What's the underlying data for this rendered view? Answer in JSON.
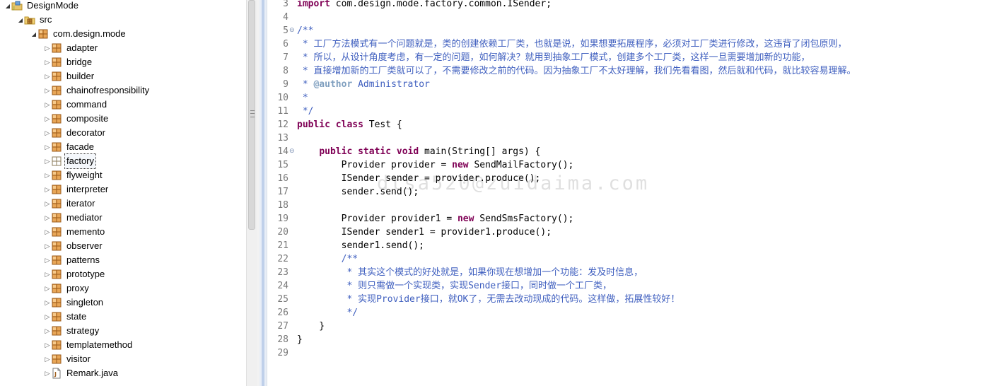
{
  "tree": {
    "items": [
      {
        "depth": 0,
        "twisty": "open",
        "icon": "project-icon",
        "label": "DesignMode"
      },
      {
        "depth": 1,
        "twisty": "open",
        "icon": "source-folder-icon",
        "label": "src"
      },
      {
        "depth": 2,
        "twisty": "open",
        "icon": "package-icon",
        "label": "com.design.mode"
      },
      {
        "depth": 3,
        "twisty": "closed",
        "icon": "package-icon",
        "label": "adapter"
      },
      {
        "depth": 3,
        "twisty": "closed",
        "icon": "package-icon",
        "label": "bridge"
      },
      {
        "depth": 3,
        "twisty": "closed",
        "icon": "package-icon",
        "label": "builder"
      },
      {
        "depth": 3,
        "twisty": "closed",
        "icon": "package-icon",
        "label": "chainofresponsibility"
      },
      {
        "depth": 3,
        "twisty": "closed",
        "icon": "package-icon",
        "label": "command"
      },
      {
        "depth": 3,
        "twisty": "closed",
        "icon": "package-icon",
        "label": "composite"
      },
      {
        "depth": 3,
        "twisty": "closed",
        "icon": "package-icon",
        "label": "decorator"
      },
      {
        "depth": 3,
        "twisty": "closed",
        "icon": "package-icon",
        "label": "facade"
      },
      {
        "depth": 3,
        "twisty": "closed",
        "icon": "empty-package-icon",
        "label": "factory",
        "selected": true
      },
      {
        "depth": 3,
        "twisty": "closed",
        "icon": "package-icon",
        "label": "flyweight"
      },
      {
        "depth": 3,
        "twisty": "closed",
        "icon": "package-icon",
        "label": "interpreter"
      },
      {
        "depth": 3,
        "twisty": "closed",
        "icon": "package-icon",
        "label": "iterator"
      },
      {
        "depth": 3,
        "twisty": "closed",
        "icon": "package-icon",
        "label": "mediator"
      },
      {
        "depth": 3,
        "twisty": "closed",
        "icon": "package-icon",
        "label": "memento"
      },
      {
        "depth": 3,
        "twisty": "closed",
        "icon": "package-icon",
        "label": "observer"
      },
      {
        "depth": 3,
        "twisty": "closed",
        "icon": "package-icon",
        "label": "patterns"
      },
      {
        "depth": 3,
        "twisty": "closed",
        "icon": "package-icon",
        "label": "prototype"
      },
      {
        "depth": 3,
        "twisty": "closed",
        "icon": "package-icon",
        "label": "proxy"
      },
      {
        "depth": 3,
        "twisty": "closed",
        "icon": "package-icon",
        "label": "singleton"
      },
      {
        "depth": 3,
        "twisty": "closed",
        "icon": "package-icon",
        "label": "state"
      },
      {
        "depth": 3,
        "twisty": "closed",
        "icon": "package-icon",
        "label": "strategy"
      },
      {
        "depth": 3,
        "twisty": "closed",
        "icon": "package-icon",
        "label": "templatemethod"
      },
      {
        "depth": 3,
        "twisty": "closed",
        "icon": "package-icon",
        "label": "visitor"
      },
      {
        "depth": 3,
        "twisty": "closed",
        "icon": "java-file-icon",
        "label": "Remark.java"
      }
    ]
  },
  "editor": {
    "watermark": "dtsa520@zuidaima.com",
    "fold_lines": [
      "5",
      "14"
    ],
    "lines": [
      {
        "num": "3",
        "tokens": [
          {
            "t": "import",
            "c": "kw"
          },
          {
            "t": " com.design.mode.factory.common.ISender;",
            "c": ""
          }
        ]
      },
      {
        "num": "4",
        "tokens": []
      },
      {
        "num": "5",
        "tokens": [
          {
            "t": "/**",
            "c": "doc"
          }
        ]
      },
      {
        "num": "6",
        "tokens": [
          {
            "t": " * 工厂方法模式有一个问题就是，类的创建依赖工厂类，也就是说，如果想要拓展程序，必须对工厂类进行修改，这违背了闭包原则，",
            "c": "doc"
          }
        ]
      },
      {
        "num": "7",
        "tokens": [
          {
            "t": " * 所以，从设计角度考虑，有一定的问题，如何解决？就用到抽象工厂模式，创建多个工厂类，这样一旦需要增加新的功能，",
            "c": "doc"
          }
        ]
      },
      {
        "num": "8",
        "tokens": [
          {
            "t": " * 直接增加新的工厂类就可以了，不需要修改之前的代码。因为抽象工厂不太好理解，我们先看看图，然后就和代码，就比较容易理解。",
            "c": "doc"
          }
        ]
      },
      {
        "num": "9",
        "tokens": [
          {
            "t": " * ",
            "c": "doc"
          },
          {
            "t": "@author",
            "c": "tag"
          },
          {
            "t": " Administrator",
            "c": "doc"
          }
        ]
      },
      {
        "num": "10",
        "tokens": [
          {
            "t": " *",
            "c": "doc"
          }
        ]
      },
      {
        "num": "11",
        "tokens": [
          {
            "t": " */",
            "c": "doc"
          }
        ]
      },
      {
        "num": "12",
        "tokens": [
          {
            "t": "public",
            "c": "kw"
          },
          {
            "t": " ",
            "c": ""
          },
          {
            "t": "class",
            "c": "kw"
          },
          {
            "t": " Test {",
            "c": ""
          }
        ]
      },
      {
        "num": "13",
        "tokens": []
      },
      {
        "num": "14",
        "tokens": [
          {
            "t": "    ",
            "c": ""
          },
          {
            "t": "public",
            "c": "kw"
          },
          {
            "t": " ",
            "c": ""
          },
          {
            "t": "static",
            "c": "kw"
          },
          {
            "t": " ",
            "c": ""
          },
          {
            "t": "void",
            "c": "kw"
          },
          {
            "t": " main(String[] args) {",
            "c": ""
          }
        ]
      },
      {
        "num": "15",
        "tokens": [
          {
            "t": "        Provider provider = ",
            "c": ""
          },
          {
            "t": "new",
            "c": "kw"
          },
          {
            "t": " SendMailFactory();",
            "c": ""
          }
        ]
      },
      {
        "num": "16",
        "tokens": [
          {
            "t": "        ISender sender = provider.produce();",
            "c": ""
          }
        ]
      },
      {
        "num": "17",
        "tokens": [
          {
            "t": "        sender.send();",
            "c": ""
          }
        ]
      },
      {
        "num": "18",
        "tokens": []
      },
      {
        "num": "19",
        "tokens": [
          {
            "t": "        Provider provider1 = ",
            "c": ""
          },
          {
            "t": "new",
            "c": "kw"
          },
          {
            "t": " SendSmsFactory();",
            "c": ""
          }
        ]
      },
      {
        "num": "20",
        "tokens": [
          {
            "t": "        ISender sender1 = provider1.produce();",
            "c": ""
          }
        ]
      },
      {
        "num": "21",
        "tokens": [
          {
            "t": "        sender1.send();",
            "c": ""
          }
        ]
      },
      {
        "num": "22",
        "tokens": [
          {
            "t": "        /**",
            "c": "doc"
          }
        ]
      },
      {
        "num": "23",
        "tokens": [
          {
            "t": "         * 其实这个模式的好处就是，如果你现在想增加一个功能：发及时信息，",
            "c": "doc"
          }
        ]
      },
      {
        "num": "24",
        "tokens": [
          {
            "t": "         * 则只需做一个实现类，实现Sender接口，同时做一个工厂类，",
            "c": "doc"
          }
        ]
      },
      {
        "num": "25",
        "tokens": [
          {
            "t": "         * 实现Provider接口，就OK了，无需去改动现成的代码。这样做，拓展性较好！",
            "c": "doc"
          }
        ]
      },
      {
        "num": "26",
        "tokens": [
          {
            "t": "         */",
            "c": "doc"
          }
        ]
      },
      {
        "num": "27",
        "tokens": [
          {
            "t": "    }",
            "c": ""
          }
        ]
      },
      {
        "num": "28",
        "tokens": [
          {
            "t": "}",
            "c": ""
          }
        ]
      },
      {
        "num": "29",
        "tokens": []
      }
    ]
  }
}
